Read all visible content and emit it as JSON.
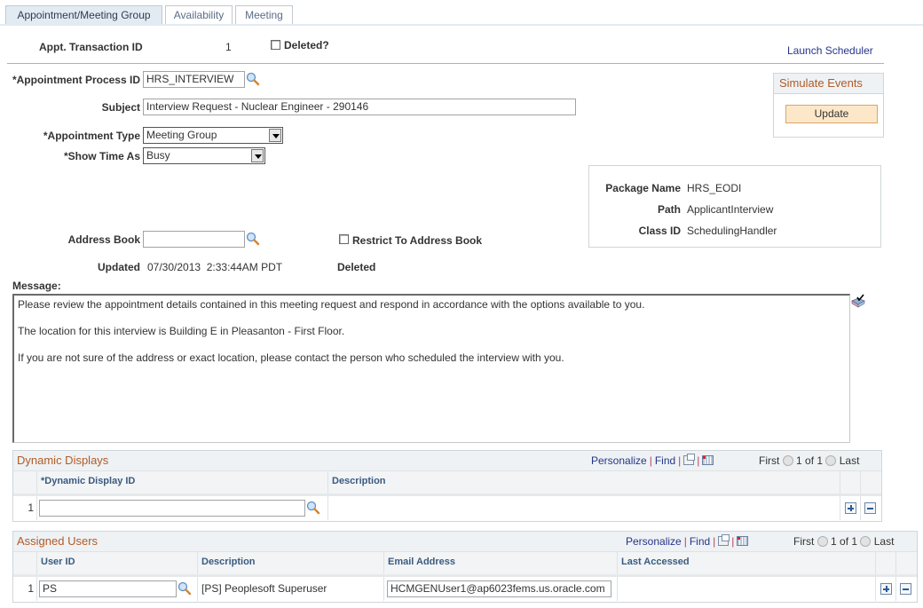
{
  "tabs": [
    {
      "label": "Appointment/Meeting Group",
      "active": true
    },
    {
      "label": "Availability",
      "active": false
    },
    {
      "label": "Meeting",
      "active": false
    }
  ],
  "header": {
    "transaction_id_label": "Appt. Transaction ID",
    "transaction_id_value": "1",
    "deleted_checkbox_label": "Deleted?",
    "deleted_checked": false,
    "launch_scheduler_link": "Launch Scheduler"
  },
  "form": {
    "process_id_label": "*Appointment Process ID",
    "process_id_value": "HRS_INTERVIEW",
    "subject_label": "Subject",
    "subject_value": "Interview Request - Nuclear Engineer - 290146",
    "appt_type_label": "*Appointment Type",
    "appt_type_value": "Meeting Group",
    "show_time_label": "*Show Time As",
    "show_time_value": "Busy",
    "address_book_label": "Address Book",
    "address_book_value": "",
    "restrict_label": "Restrict To Address Book",
    "restrict_checked": false,
    "updated_label": "Updated",
    "updated_value": "07/30/2013  2:33:44AM PDT",
    "deleted_status": "Deleted",
    "message_label": "Message:",
    "message_lines": [
      "Please review the appointment details contained in this meeting request and respond in accordance with the options available to you.",
      "The location for this interview is Building E in Pleasanton - First Floor.",
      "If you are not sure of the address or exact location, please contact the person who scheduled the interview with you."
    ]
  },
  "simulate_events": {
    "title": "Simulate Events",
    "update_button": "Update"
  },
  "package_info": {
    "package_name_label": "Package Name",
    "package_name_value": "HRS_EODI",
    "path_label": "Path",
    "path_value": "ApplicantInterview",
    "class_id_label": "Class ID",
    "class_id_value": "SchedulingHandler"
  },
  "dynamic_displays": {
    "title": "Dynamic Displays",
    "personalize": "Personalize",
    "find": "Find",
    "first": "First",
    "pager": "1 of 1",
    "last": "Last",
    "columns": [
      "*Dynamic Display ID",
      "Description"
    ],
    "rows": [
      {
        "num": "1",
        "id": "",
        "description": ""
      }
    ]
  },
  "assigned_users": {
    "title": "Assigned Users",
    "personalize": "Personalize",
    "find": "Find",
    "first": "First",
    "pager": "1 of 1",
    "last": "Last",
    "columns": [
      "User ID",
      "Description",
      "Email Address",
      "Last Accessed"
    ],
    "rows": [
      {
        "num": "1",
        "user_id": "PS",
        "description": "[PS] Peoplesoft Superuser",
        "email": "HCMGENUser1@ap6023fems.us.oracle.com",
        "last_accessed": ""
      }
    ]
  },
  "colors": {
    "group_title": "#b25a26",
    "link": "#26358a",
    "column_header": "#3a5a80",
    "update_button_bg": "#fce8c8"
  }
}
